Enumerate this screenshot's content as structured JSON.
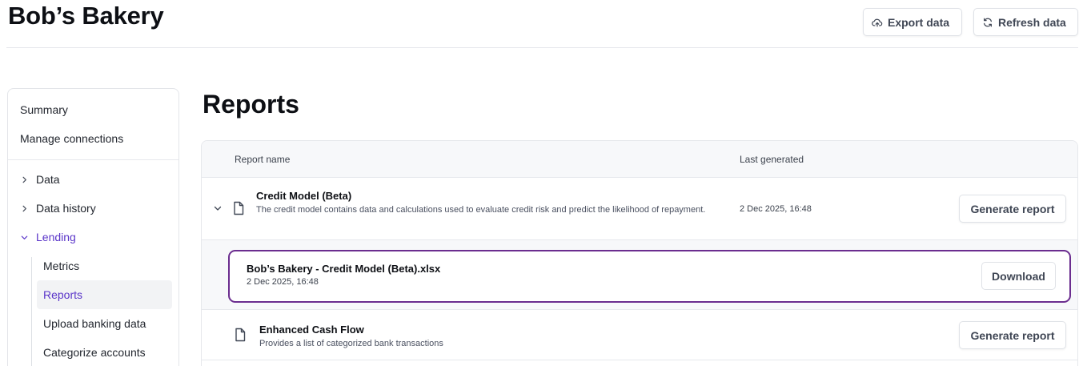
{
  "header": {
    "title": "Bob’s Bakery",
    "export_label": "Export data",
    "refresh_label": "Refresh data"
  },
  "sidebar": {
    "items": [
      "Summary",
      "Manage connections"
    ],
    "groups": [
      {
        "label": "Data",
        "expanded": false
      },
      {
        "label": "Data history",
        "expanded": false
      },
      {
        "label": "Lending",
        "expanded": true
      }
    ],
    "sub_items": [
      "Metrics",
      "Reports",
      "Upload banking data",
      "Categorize accounts"
    ],
    "active_sub_item": "Reports"
  },
  "main": {
    "title": "Reports",
    "columns": [
      "Report name",
      "Last generated"
    ],
    "reports": [
      {
        "name": "Credit Model (Beta)",
        "description": "The credit model contains data and calculations used to evaluate credit risk and predict the likelihood of repayment.",
        "last_generated": "2 Dec 2025, 16:48",
        "action": "Generate report"
      },
      {
        "name": "Enhanced Cash Flow",
        "description": "Provides a list of categorized bank transactions",
        "last_generated": "",
        "action": "Generate report"
      }
    ],
    "file": {
      "name": "Bob’s Bakery - Credit Model (Beta).xlsx",
      "date": "2 Dec 2025, 16:48",
      "action": "Download"
    }
  },
  "colors": {
    "accent": "#5a35c9",
    "focus_border": "#6b2d8f"
  }
}
